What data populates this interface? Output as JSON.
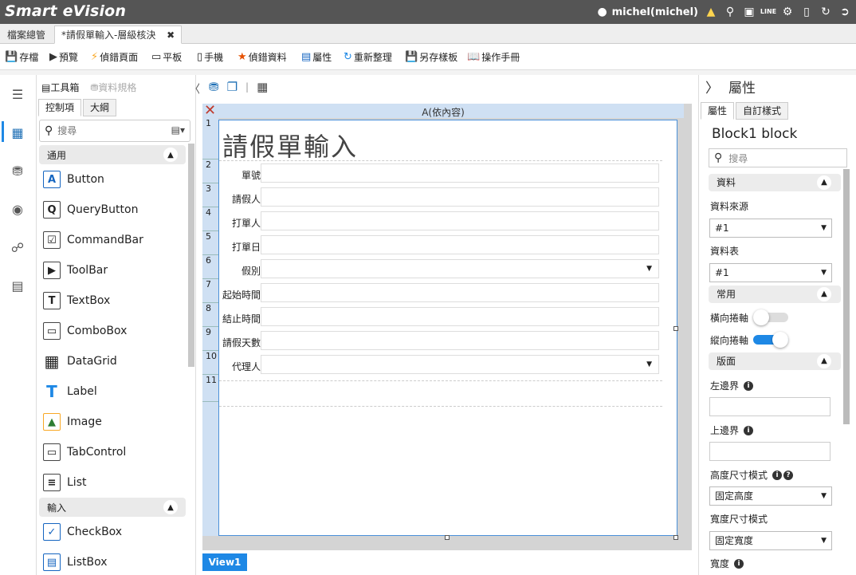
{
  "app": {
    "title": "Smart eVision",
    "user": "michel(michel)",
    "line_label": "LINE"
  },
  "tabs": [
    {
      "label": "檔案總管"
    },
    {
      "label": "*請假單輸入-層級核決",
      "close": "✖"
    }
  ],
  "toolbar": {
    "save": "存檔",
    "preview": "預覽",
    "debug_page": "偵錯頁面",
    "tablet": "平板",
    "phone": "手機",
    "debug_data": "偵錯資料",
    "properties": "屬性",
    "reorganize": "重新整理",
    "save_template": "另存樣板",
    "manual": "操作手冊"
  },
  "left_panel": {
    "toolbox": "工具箱",
    "data_spec": "資料規格",
    "tab_controls": "控制項",
    "tab_outline": "大綱",
    "search_placeholder": "搜尋",
    "section_general": "通用",
    "section_input": "輸入",
    "items": [
      {
        "label": "Button",
        "icon": "A"
      },
      {
        "label": "QueryButton",
        "icon": "Q"
      },
      {
        "label": "CommandBar",
        "icon": "☑"
      },
      {
        "label": "ToolBar",
        "icon": "▶"
      },
      {
        "label": "TextBox",
        "icon": "T"
      },
      {
        "label": "ComboBox",
        "icon": "▭"
      },
      {
        "label": "DataGrid",
        "icon": "▦"
      },
      {
        "label": "Label",
        "icon": "T"
      },
      {
        "label": "Image",
        "icon": "▲"
      },
      {
        "label": "TabControl",
        "icon": "▭"
      },
      {
        "label": "List",
        "icon": "≡"
      }
    ],
    "input_items": [
      {
        "label": "CheckBox",
        "icon": "✓"
      },
      {
        "label": "ListBox",
        "icon": "▤"
      }
    ]
  },
  "designer": {
    "column_header": "A(依內容)",
    "form_title": "請假單輸入",
    "row_numbers": [
      "1",
      "2",
      "3",
      "4",
      "5",
      "6",
      "7",
      "8",
      "9",
      "10",
      "11"
    ],
    "fields": [
      {
        "label": "單號",
        "dropdown": false
      },
      {
        "label": "請假人",
        "dropdown": false
      },
      {
        "label": "打單人",
        "dropdown": false
      },
      {
        "label": "打單日",
        "dropdown": false
      },
      {
        "label": "假別",
        "dropdown": true
      },
      {
        "label": "起始時間",
        "dropdown": false
      },
      {
        "label": "結止時間",
        "dropdown": false
      },
      {
        "label": "請假天數",
        "dropdown": false
      },
      {
        "label": "代理人",
        "dropdown": true
      }
    ],
    "view_tab": "View1"
  },
  "right_panel": {
    "title": "屬性",
    "tab_properties": "屬性",
    "tab_custom_style": "自訂樣式",
    "block_name": "Block1 block",
    "search_placeholder": "搜尋",
    "section_data": "資料",
    "data_source_label": "資料來源",
    "data_source_value": "#1",
    "data_table_label": "資料表",
    "data_table_value": "#1",
    "section_common": "常用",
    "h_scroll_label": "橫向捲軸",
    "h_scroll_on": false,
    "v_scroll_label": "縱向捲軸",
    "v_scroll_on": true,
    "section_layout": "版面",
    "left_border_label": "左邊界",
    "top_border_label": "上邊界",
    "height_mode_label": "高度尺寸模式",
    "height_mode_value": "固定高度",
    "width_mode_label": "寬度尺寸模式",
    "width_mode_value": "固定寬度",
    "width_label": "寬度"
  },
  "colors": {
    "accent": "#1e88e5",
    "topbar": "#555555",
    "header_blue": "#cfe0f3"
  }
}
